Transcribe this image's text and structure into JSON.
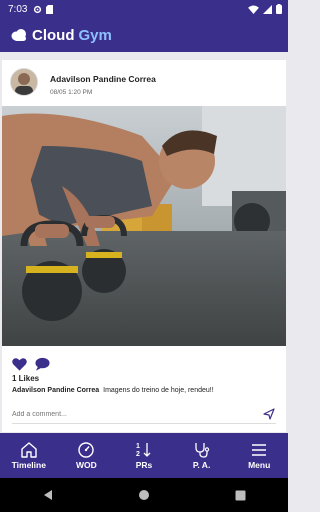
{
  "status_bar": {
    "time": "7:03"
  },
  "app_bar": {
    "logo_part1": "Cloud",
    "logo_part2": "Gym"
  },
  "post": {
    "author": "Adavilson Pandine Correa",
    "timestamp": "08/05 1:20 PM",
    "likes": "1 Likes",
    "caption_author": "Adavilson Pandine Correa",
    "caption_text": "Imagens do treino de hoje, rendeu!!",
    "comment_placeholder": "Add a comment..."
  },
  "bottom_nav": {
    "items": [
      {
        "label": "Timeline",
        "icon": "home-icon"
      },
      {
        "label": "WOD",
        "icon": "gauge-icon"
      },
      {
        "label": "PRs",
        "icon": "sort-icon"
      },
      {
        "label": "P. A.",
        "icon": "stethoscope-icon"
      },
      {
        "label": "Menu",
        "icon": "menu-icon"
      }
    ]
  },
  "colors": {
    "primary": "#3b2f8c",
    "accent": "#8ec0ff"
  }
}
